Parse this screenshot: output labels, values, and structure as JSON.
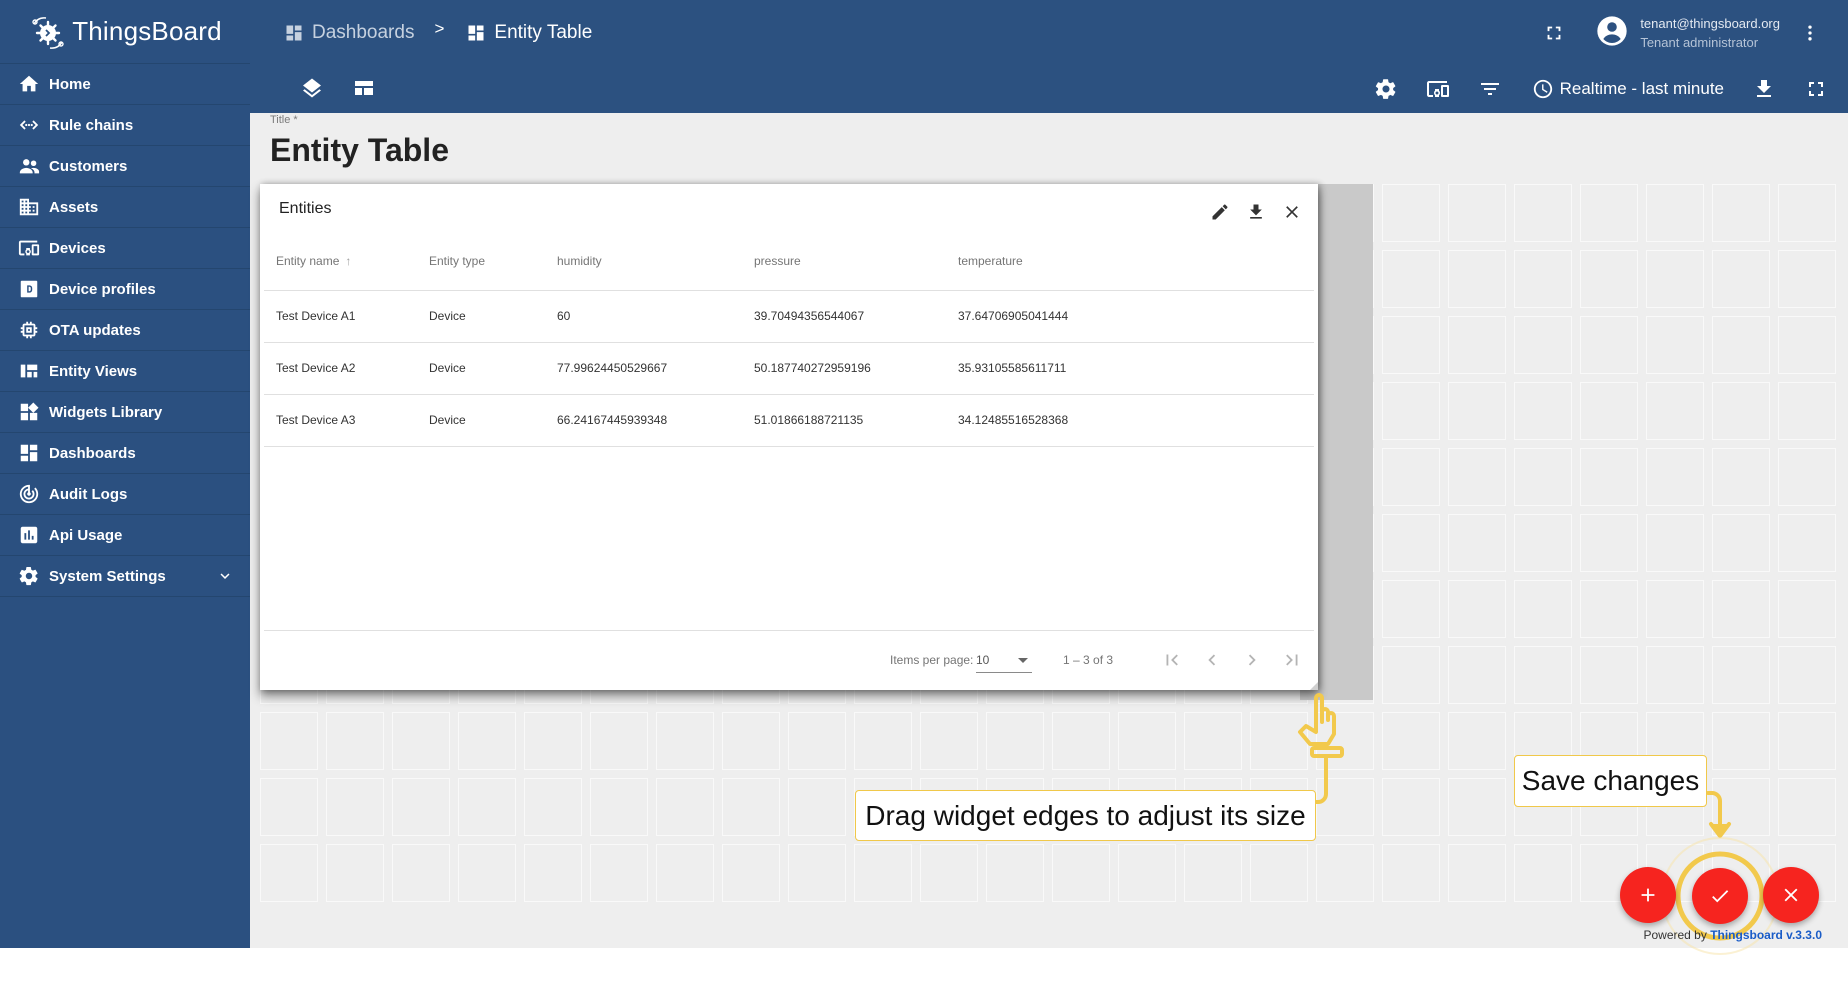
{
  "app": {
    "brand": "ThingsBoard",
    "logo_icon": "thingsboard-logo-icon"
  },
  "sidebar": {
    "items": [
      {
        "label": "Home",
        "icon": "home-icon"
      },
      {
        "label": "Rule chains",
        "icon": "code-arrows-icon"
      },
      {
        "label": "Customers",
        "icon": "people-icon"
      },
      {
        "label": "Assets",
        "icon": "domain-icon"
      },
      {
        "label": "Devices",
        "icon": "devices-icon"
      },
      {
        "label": "Device profiles",
        "icon": "device-profile-icon"
      },
      {
        "label": "OTA updates",
        "icon": "memory-chip-icon"
      },
      {
        "label": "Entity Views",
        "icon": "view-quilt-icon"
      },
      {
        "label": "Widgets Library",
        "icon": "widgets-icon"
      },
      {
        "label": "Dashboards",
        "icon": "dashboard-icon"
      },
      {
        "label": "Audit Logs",
        "icon": "track-changes-icon"
      },
      {
        "label": "Api Usage",
        "icon": "insert-chart-icon"
      },
      {
        "label": "System Settings",
        "icon": "settings-icon",
        "expandable": true
      }
    ]
  },
  "header": {
    "breadcrumb": [
      {
        "label": "Dashboards",
        "icon": "dashboard-icon"
      },
      {
        "label": "Entity Table",
        "icon": "dashboard-icon"
      }
    ],
    "breadcrumb_separator": ">",
    "user": {
      "email": "tenant@thingsboard.org",
      "role": "Tenant administrator"
    },
    "toolbar": {
      "time_window": "Realtime - last minute"
    }
  },
  "dashboard": {
    "title_label": "Title *",
    "title": "Entity Table"
  },
  "widget": {
    "title": "Entities",
    "columns": [
      "Entity name",
      "Entity type",
      "humidity",
      "pressure",
      "temperature"
    ],
    "sorted_column": "Entity name",
    "sort_direction": "ascending",
    "rows": [
      [
        "Test Device A1",
        "Device",
        "60",
        "39.70494356544067",
        "37.64706905041444"
      ],
      [
        "Test Device A2",
        "Device",
        "77.99624450529667",
        "50.187740272959196",
        "35.93105585611711"
      ],
      [
        "Test Device A3",
        "Device",
        "66.24167445939348",
        "51.01866188721135",
        "34.12485516528368"
      ]
    ],
    "paginator": {
      "items_per_page_label": "Items per page:",
      "items_per_page": "10",
      "range": "1 – 3 of 3"
    }
  },
  "hints": {
    "resize": "Drag widget edges to adjust its size",
    "save": "Save changes"
  },
  "footer": {
    "powered_by": "Powered by",
    "version_link": "Thingsboard v.3.3.0"
  },
  "colors": {
    "primary": "#2b5080",
    "fab": "#f6241f",
    "hint_accent": "#f0c84a"
  }
}
